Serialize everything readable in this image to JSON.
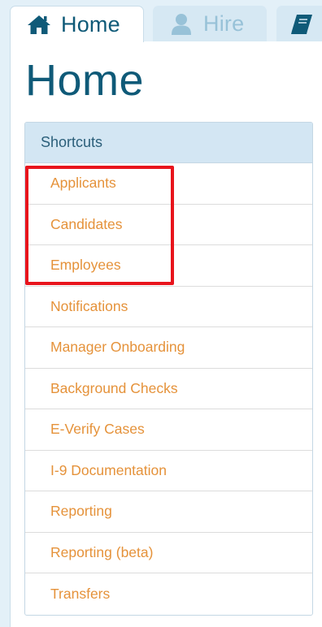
{
  "tabs": [
    {
      "label": "Home",
      "icon": "home-icon",
      "active": true
    },
    {
      "label": "Hire",
      "icon": "person-icon",
      "active": false
    },
    {
      "label": "",
      "icon": "book-icon",
      "active": false
    }
  ],
  "page": {
    "title": "Home"
  },
  "shortcuts": {
    "header": "Shortcuts",
    "items": [
      {
        "label": "Applicants"
      },
      {
        "label": "Candidates"
      },
      {
        "label": "Employees"
      },
      {
        "label": "Notifications"
      },
      {
        "label": "Manager Onboarding"
      },
      {
        "label": "Background Checks"
      },
      {
        "label": "E-Verify Cases"
      },
      {
        "label": "I-9 Documentation"
      },
      {
        "label": "Reporting"
      },
      {
        "label": "Reporting (beta)"
      },
      {
        "label": "Transfers"
      }
    ]
  },
  "colors": {
    "title": "#0f5a78",
    "link": "#e5923a",
    "header_bg": "#d3e6f3",
    "highlight": "#e8141c",
    "page_bg": "#e3f0f8"
  }
}
